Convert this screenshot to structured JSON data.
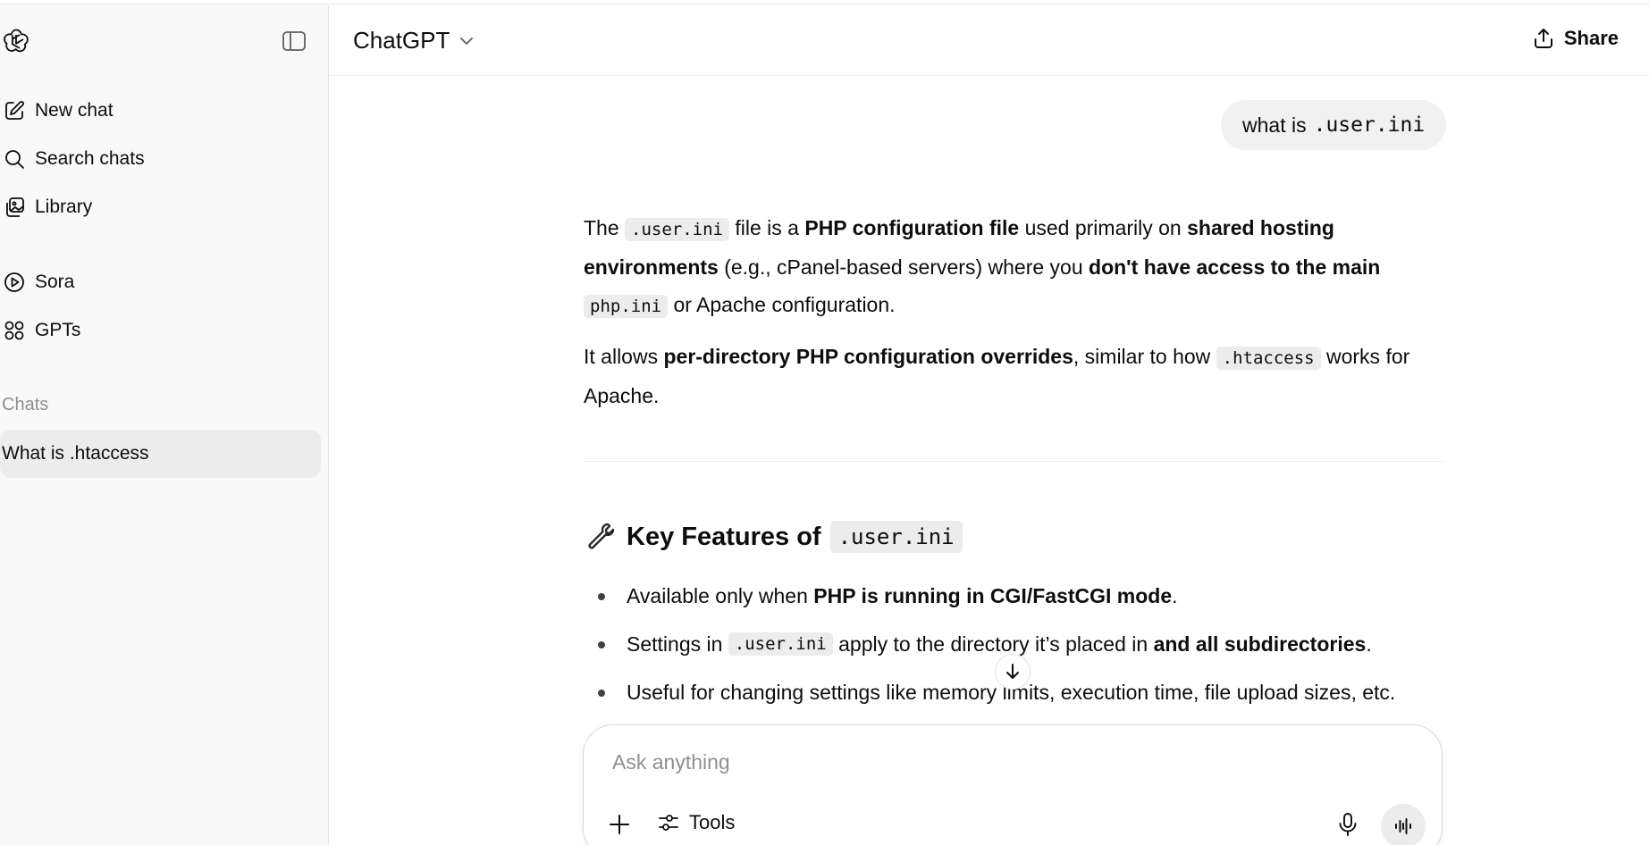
{
  "sidebar": {
    "logo_icon": "openai-logo-icon",
    "toggle_icon": "sidebar-toggle-icon",
    "items": [
      {
        "label": "New chat",
        "icon": "edit-icon"
      },
      {
        "label": "Search chats",
        "icon": "search-icon"
      },
      {
        "label": "Library",
        "icon": "library-icon"
      },
      {
        "label": "Sora",
        "icon": "play-circle-icon"
      },
      {
        "label": "GPTs",
        "icon": "grid-icon"
      }
    ],
    "section_label": "Chats",
    "chats": [
      {
        "title": "What is .htaccess",
        "active": true
      }
    ]
  },
  "header": {
    "model": "ChatGPT",
    "share_label": "Share"
  },
  "conversation": {
    "user_message": {
      "prefix": "what is",
      "code": ".user.ini"
    },
    "answer": {
      "p1": {
        "t1": "The",
        "c1": ".user.ini",
        "t2": "file is a",
        "b1": "PHP configuration file",
        "t3": "used primarily on",
        "b2": "shared hosting environments",
        "t4": "(e.g., cPanel-based servers) where you",
        "b3": "don't have access to the main",
        "c2": "php.ini",
        "t5": "or Apache configuration."
      },
      "p2": {
        "t1": "It allows",
        "b1": "per-directory PHP configuration overrides",
        "t2": ", similar to how",
        "c1": ".htaccess",
        "t3": "works for Apache."
      },
      "heading": {
        "icon": "wrench-icon",
        "text": "Key Features of",
        "code": ".user.ini"
      },
      "bullets": {
        "b1": {
          "t1": "Available only when",
          "bold": "PHP is running in CGI/FastCGI mode",
          "t2": "."
        },
        "b2": {
          "t1": "Settings in",
          "code": ".user.ini",
          "t2": "apply to the directory it’s placed in",
          "bold": "and all subdirectories",
          "t3": "."
        },
        "b3": {
          "t1": "Useful for changing settings like memory limits, execution time, file upload sizes, etc."
        }
      }
    }
  },
  "composer": {
    "placeholder": "Ask anything",
    "tools_label": "Tools"
  },
  "colors": {
    "sidebar_bg": "#f9f9f9",
    "active_chat_bg": "#ececec",
    "bubble_bg": "#f1f1f1",
    "code_bg": "#ececec",
    "text": "#0d0d0d",
    "muted": "#8f8f8f"
  }
}
